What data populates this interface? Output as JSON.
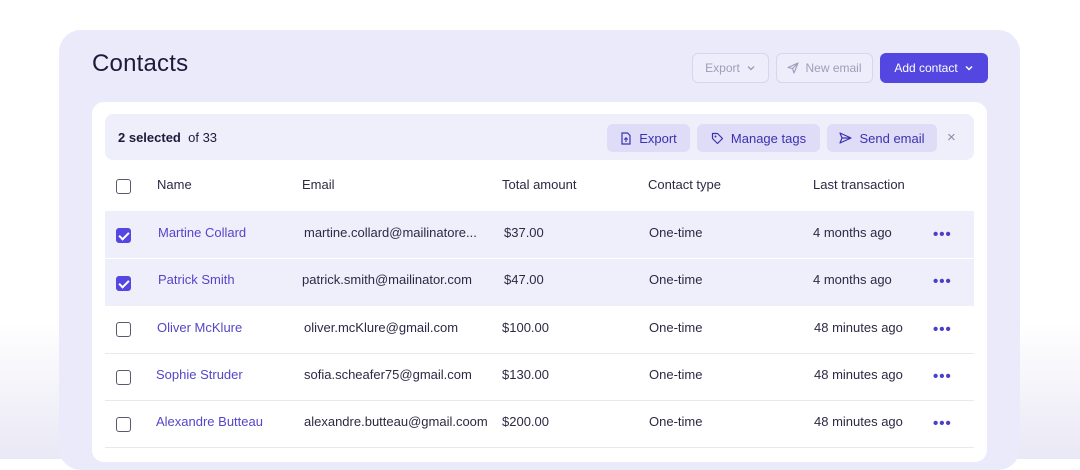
{
  "header": {
    "title": "Contacts",
    "export_label": "Export",
    "new_email_label": "New email",
    "add_contact_label": "Add contact"
  },
  "selection": {
    "count_label": "2 selected",
    "total_label": "of 33",
    "export_label": "Export",
    "manage_tags_label": "Manage tags",
    "send_email_label": "Send email",
    "close_label": "×"
  },
  "table": {
    "columns": [
      "Name",
      "Email",
      "Total amount",
      "Contact type",
      "Last transaction"
    ],
    "rows": [
      {
        "name": "Martine Collard",
        "email": "martine.collard@mailinatore...",
        "amount": "$37.00",
        "type": "One-time",
        "last": "4 months ago",
        "selected": true
      },
      {
        "name": "Patrick Smith",
        "email": "patrick.smith@mailinator.com",
        "amount": "$47.00",
        "type": "One-time",
        "last": "4 months ago",
        "selected": true
      },
      {
        "name": "Oliver McKlure",
        "email": "oliver.mcKlure@gmail.com",
        "amount": "$100.00",
        "type": "One-time",
        "last": "48 minutes ago",
        "selected": false
      },
      {
        "name": "Sophie Struder",
        "email": "sofia.scheafer75@gmail.com",
        "amount": "$130.00",
        "type": "One-time",
        "last": "48 minutes ago",
        "selected": false
      },
      {
        "name": "Alexandre Butteau",
        "email": "alexandre.butteau@gmail.coom",
        "amount": "$200.00",
        "type": "One-time",
        "last": "48 minutes ago",
        "selected": false
      }
    ],
    "row_menu_label": "•••"
  },
  "colors": {
    "accent": "#5446e0",
    "card_bg": "#ebeafb",
    "selected_row": "#efeefb",
    "link_text": "#5446c8"
  },
  "icons": {
    "export": "file-export-icon",
    "new_email": "paper-plane-icon",
    "dropdown": "chevron-down-icon",
    "manage_tags": "tag-icon",
    "send_email": "send-icon",
    "close": "close-icon",
    "row_menu": "more-horizontal-icon"
  }
}
